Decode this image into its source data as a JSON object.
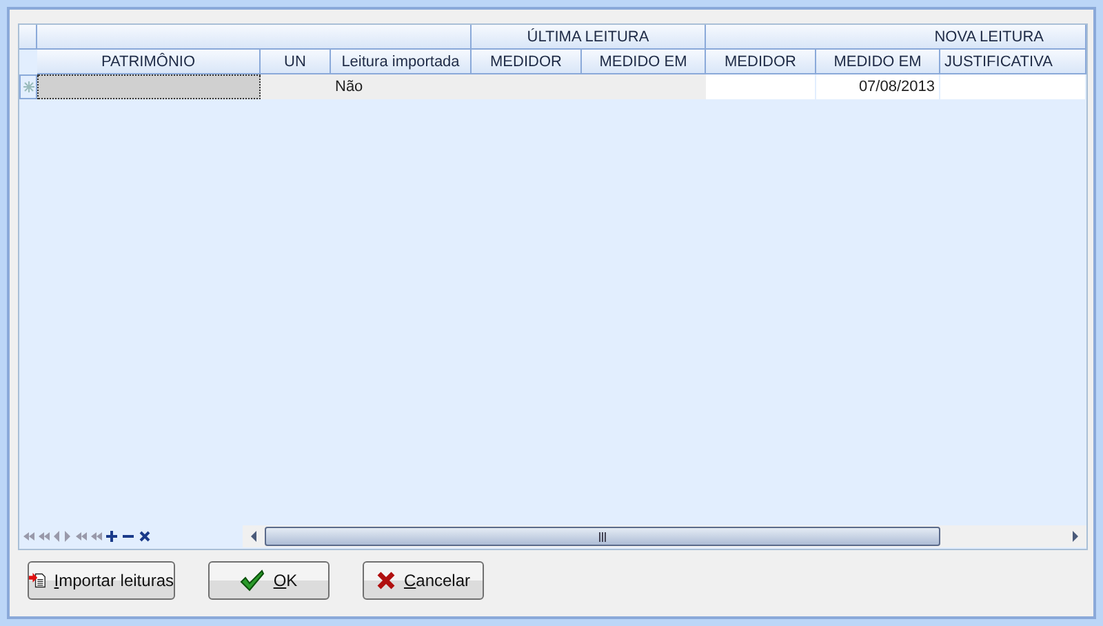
{
  "grid": {
    "groups": [
      {
        "label": "ÚLTIMA LEITURA"
      },
      {
        "label": "NOVA LEITURA"
      }
    ],
    "columns": [
      "PATRIMÔNIO",
      "UN",
      "Leitura importada",
      "MEDIDOR",
      "MEDIDO EM",
      "MEDIDOR",
      "MEDIDO EM",
      "JUSTIFICATIVA"
    ],
    "new_row": {
      "leitura_importada": "Não",
      "nova_medido_em": "07/08/2013"
    }
  },
  "buttons": [
    {
      "label": "Importar leituras",
      "kind": "import"
    },
    {
      "label": "OK",
      "kind": "ok"
    },
    {
      "label": "Cancelar",
      "kind": "cancel"
    }
  ]
}
